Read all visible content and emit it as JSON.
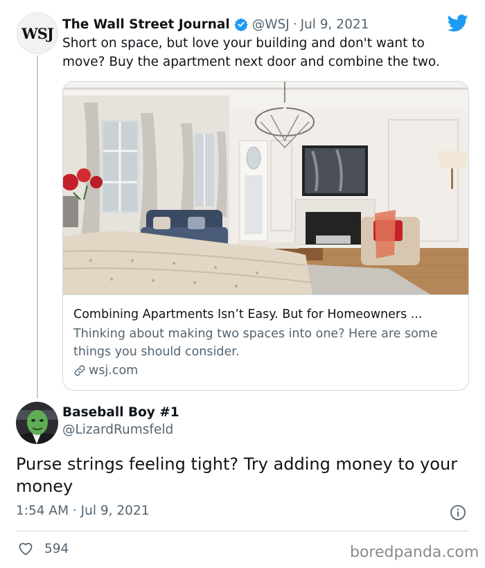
{
  "parent_tweet": {
    "avatar_text": "WSJ",
    "name": "The Wall Street Journal",
    "handle": "@WSJ",
    "separator": "·",
    "date": "Jul 9, 2021",
    "text": "Short on space, but love your building and don't want to move? Buy the apartment next door and combine the two.",
    "card": {
      "title": "Combining Apartments Isn’t Easy. But for Homeowners ...",
      "description": "Thinking about making two spaces into one? Here are some things you should consider.",
      "domain": "wsj.com"
    }
  },
  "reply_tweet": {
    "name": "Baseball Boy #1",
    "handle": "@LizardRumsfeld",
    "text": "Purse strings feeling tight? Try adding money to your money",
    "timestamp": "1:54 AM · Jul 9, 2021",
    "like_count": "594"
  },
  "watermark": "boredpanda.com",
  "icons": {
    "verified": "verified-badge-icon",
    "platform": "twitter-bird-icon",
    "link": "link-icon",
    "info": "info-icon",
    "like": "heart-icon"
  },
  "colors": {
    "brand_blue": "#1d9bf0",
    "text_primary": "#0f1419",
    "text_secondary": "#536471",
    "border": "#cfd9de"
  }
}
